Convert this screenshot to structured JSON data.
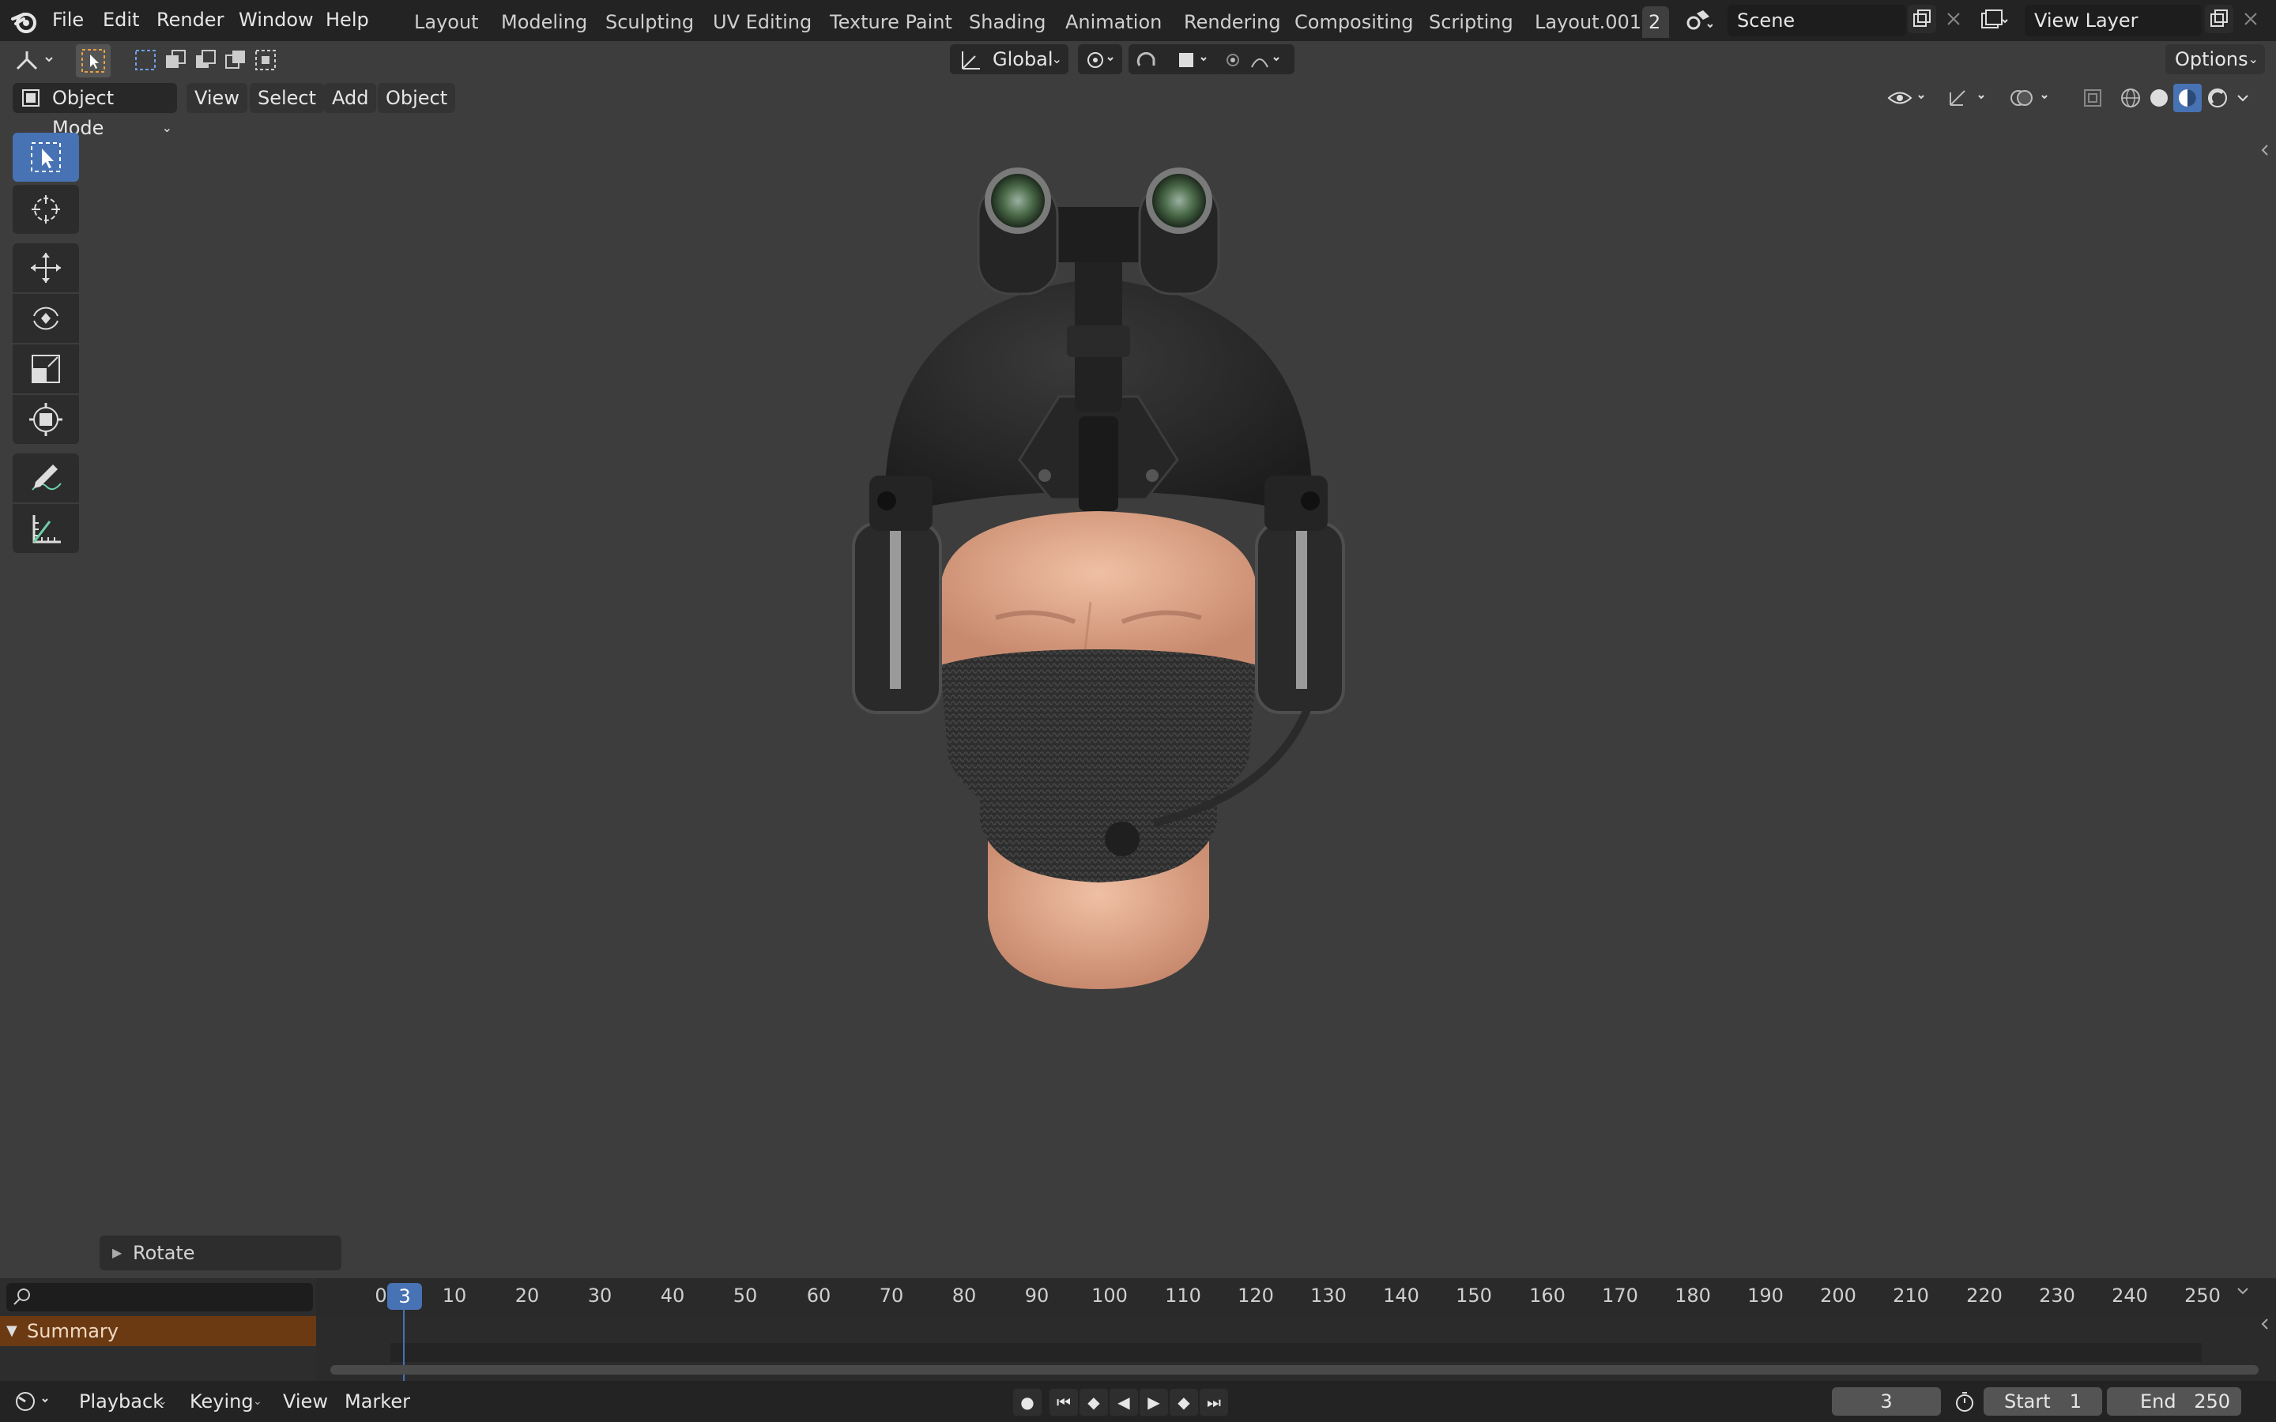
{
  "topbar": {
    "menus": [
      "File",
      "Edit",
      "Render",
      "Window",
      "Help"
    ],
    "workspaces": [
      "Layout",
      "Modeling",
      "Sculpting",
      "UV Editing",
      "Texture Paint",
      "Shading",
      "Animation",
      "Rendering",
      "Compositing",
      "Scripting",
      "Layout.001"
    ],
    "workspace_overflow": "2",
    "scene_name": "Scene",
    "view_layer_name": "View Layer"
  },
  "tool_header": {
    "transform_orientation": "Global",
    "options_label": "Options"
  },
  "view_header": {
    "mode": "Object Mode",
    "menus": [
      "View",
      "Select",
      "Add",
      "Object"
    ]
  },
  "toolbar": {
    "tools": [
      "select-box",
      "cursor",
      "move",
      "rotate",
      "scale",
      "transform",
      "annotate",
      "measure"
    ],
    "active_tool": "select-box"
  },
  "operator_panel": {
    "label": "Rotate"
  },
  "timeline": {
    "current_frame_badge": "3",
    "ruler_start_label": "0",
    "ticks": [
      "10",
      "20",
      "30",
      "40",
      "50",
      "60",
      "70",
      "80",
      "90",
      "100",
      "110",
      "120",
      "130",
      "140",
      "150",
      "160",
      "170",
      "180",
      "190",
      "200",
      "210",
      "220",
      "230",
      "240",
      "250"
    ],
    "summary_label": "Summary"
  },
  "bottombar": {
    "menus": [
      "Playback",
      "Keying",
      "View",
      "Marker"
    ],
    "current_frame": "3",
    "start_label": "Start",
    "start_value": "1",
    "end_label": "End",
    "end_value": "250"
  },
  "colors": {
    "accent": "#4772b3",
    "summary": "#6b3a12",
    "background": "#3d3d3d",
    "header": "#232323"
  }
}
